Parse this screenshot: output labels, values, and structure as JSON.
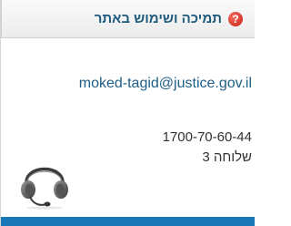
{
  "header": {
    "title": "תמיכה ושימוש באתר",
    "help_icon_glyph": "?",
    "help_icon_color": "#d8291e",
    "title_color": "#1d5a7c"
  },
  "contact": {
    "email": "moked-tagid@justice.gov.il",
    "phone": "1700-70-60-44",
    "extension": "שלוחה 3"
  },
  "icons": {
    "headset": "headset-icon"
  },
  "colors": {
    "bottom_bar": "#1977b6",
    "link": "#1f5d86"
  }
}
